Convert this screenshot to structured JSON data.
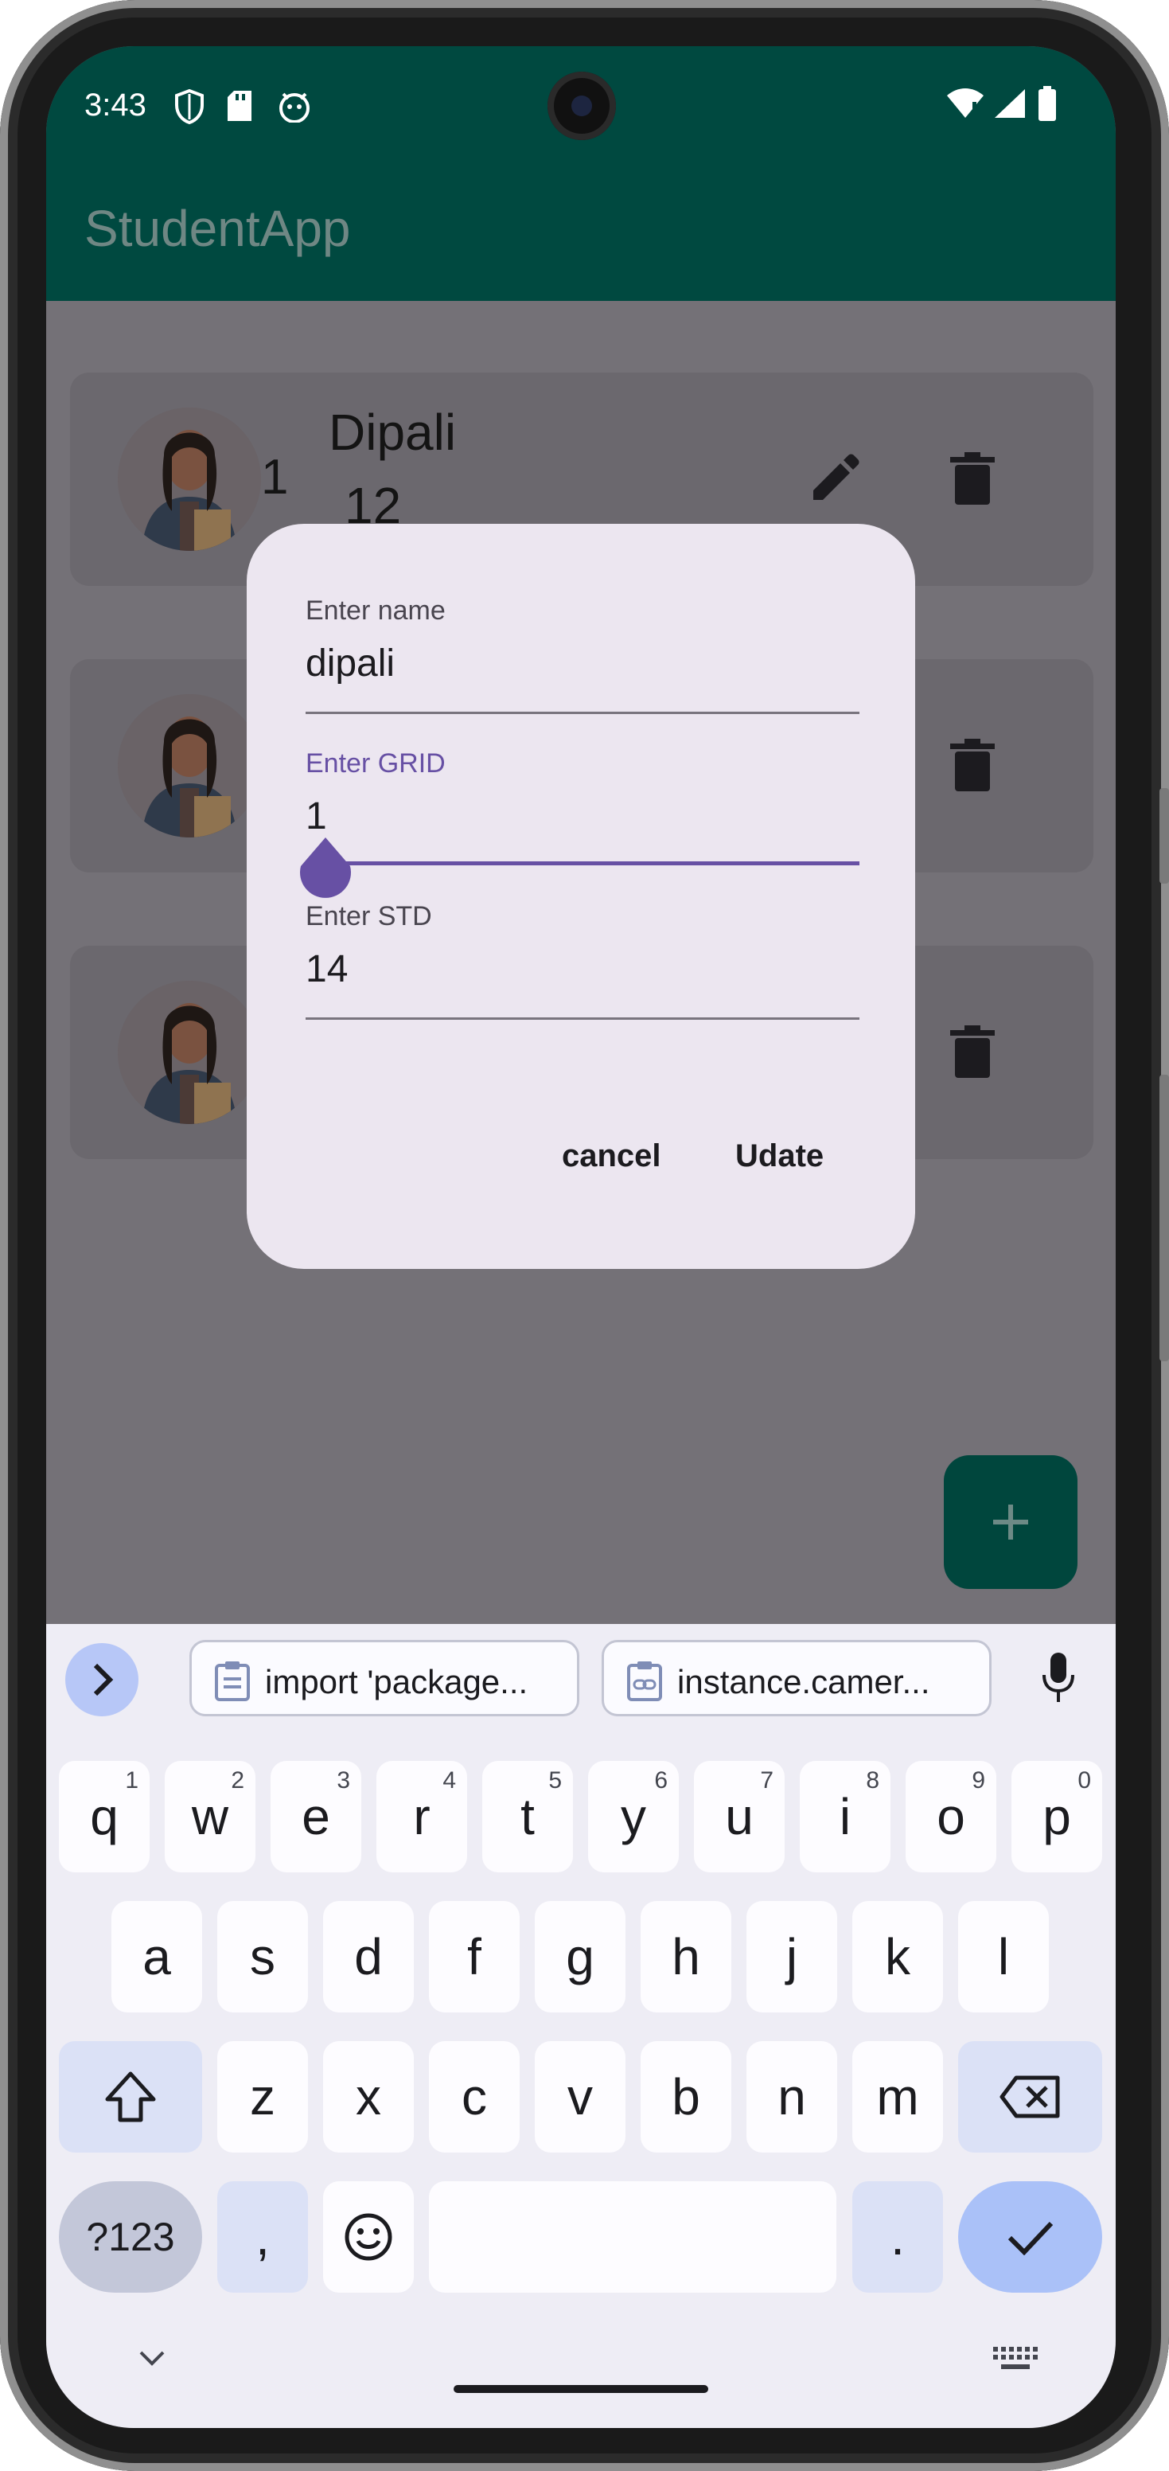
{
  "status_bar": {
    "time": "3:43"
  },
  "app_bar": {
    "title": "StudentApp"
  },
  "students": [
    {
      "grid": "1",
      "name": "Dipali",
      "std": "12"
    },
    {
      "grid": "",
      "name": "",
      "std": ""
    },
    {
      "grid": "",
      "name": "",
      "std": ""
    }
  ],
  "dialog": {
    "name_label": "Enter name",
    "name_value": "dipali",
    "grid_label": "Enter GRID",
    "grid_value": "1",
    "std_label": "Enter STD",
    "std_value": "14",
    "cancel_label": "cancel",
    "update_label": "Udate"
  },
  "fab": {
    "icon": "plus-icon"
  },
  "keyboard": {
    "suggestions": [
      "import 'package...",
      "instance.camer..."
    ],
    "row1": [
      {
        "key": "q",
        "hint": "1"
      },
      {
        "key": "w",
        "hint": "2"
      },
      {
        "key": "e",
        "hint": "3"
      },
      {
        "key": "r",
        "hint": "4"
      },
      {
        "key": "t",
        "hint": "5"
      },
      {
        "key": "y",
        "hint": "6"
      },
      {
        "key": "u",
        "hint": "7"
      },
      {
        "key": "i",
        "hint": "8"
      },
      {
        "key": "o",
        "hint": "9"
      },
      {
        "key": "p",
        "hint": "0"
      }
    ],
    "row2": [
      "a",
      "s",
      "d",
      "f",
      "g",
      "h",
      "j",
      "k",
      "l"
    ],
    "row3": [
      "z",
      "x",
      "c",
      "v",
      "b",
      "n",
      "m"
    ],
    "symbols_label": "?123",
    "comma": ",",
    "period": "."
  },
  "colors": {
    "app_bar": "#004940",
    "accent": "#6750a4",
    "dialog_bg": "#ece6f0",
    "scrim_bg": "#747177",
    "enter_key": "#aac1f8"
  }
}
